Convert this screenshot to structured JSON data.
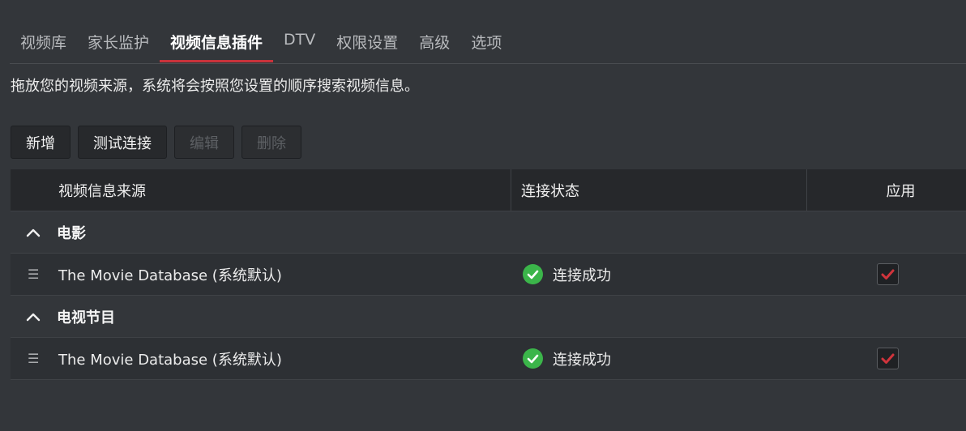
{
  "tabs": [
    {
      "label": "视频库",
      "active": false
    },
    {
      "label": "家长监护",
      "active": false
    },
    {
      "label": "视频信息插件",
      "active": true
    },
    {
      "label": "DTV",
      "active": false
    },
    {
      "label": "权限设置",
      "active": false
    },
    {
      "label": "高级",
      "active": false
    },
    {
      "label": "选项",
      "active": false
    }
  ],
  "description": "拖放您的视频来源，系统将会按照您设置的顺序搜索视频信息。",
  "toolbar": {
    "add_label": "新增",
    "test_label": "测试连接",
    "edit_label": "编辑",
    "delete_label": "删除",
    "edit_disabled": true,
    "delete_disabled": true
  },
  "table": {
    "headers": {
      "source": "视频信息来源",
      "status": "连接状态",
      "apply": "应用"
    },
    "groups": [
      {
        "title": "电影",
        "expanded": true,
        "rows": [
          {
            "name": "The Movie Database (系统默认)",
            "status": "连接成功",
            "applied": true
          }
        ]
      },
      {
        "title": "电视节目",
        "expanded": true,
        "rows": [
          {
            "name": "The Movie Database (系统默认)",
            "status": "连接成功",
            "applied": true
          }
        ]
      }
    ]
  },
  "icons": {
    "group_toggle": "chevron-up-icon",
    "drag": "drag-handle-icon",
    "status_ok": "check-circle-icon",
    "applied": "checkbox-checked-icon"
  },
  "colors": {
    "accent": "#c9323b",
    "success": "#3bb54a",
    "check_mark": "#d0343c",
    "background": "#33363a"
  }
}
